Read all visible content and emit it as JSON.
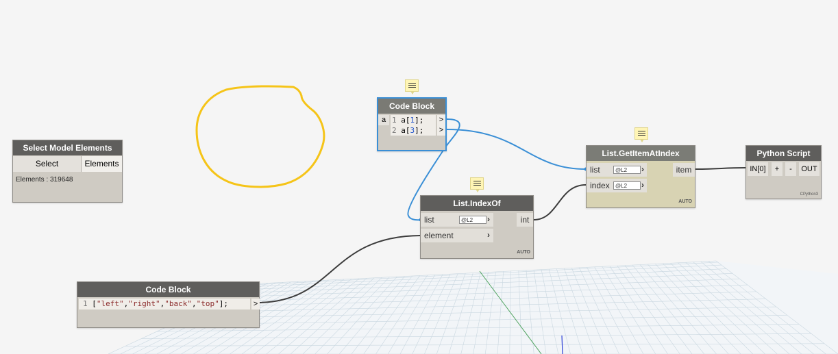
{
  "select_model_elements": {
    "title": "Select Model Elements",
    "select_button": "Select",
    "output_label": "Elements",
    "status": "Elements : 319648"
  },
  "code_block_top": {
    "title": "Code Block",
    "input_label": "a",
    "lines": [
      {
        "num": "1",
        "pre": "a[",
        "idx": "1",
        "post": "];"
      },
      {
        "num": "2",
        "pre": "a[",
        "idx": "3",
        "post": "];"
      }
    ],
    "out_glyph": ">"
  },
  "code_block_bottom": {
    "title": "Code Block",
    "line_num": "1",
    "open": "[",
    "strings": [
      "\"left\"",
      "\"right\"",
      "\"back\"",
      "\"top\""
    ],
    "close": "];",
    "sep": ",",
    "out_glyph": ">"
  },
  "list_index_of": {
    "title": "List.IndexOf",
    "inputs": [
      {
        "label": "list",
        "lacing": "@L2"
      },
      {
        "label": "element"
      }
    ],
    "output": "int",
    "mode": "AUTO"
  },
  "list_get_item": {
    "title": "List.GetItemAtIndex",
    "inputs": [
      {
        "label": "list",
        "lacing": "@L2"
      },
      {
        "label": "index",
        "lacing": "@L2"
      }
    ],
    "output": "item",
    "mode": "AUTO"
  },
  "python_script": {
    "title": "Python Script",
    "input": "IN[0]",
    "add": "+",
    "remove": "-",
    "output": "OUT",
    "engine": "CPython3"
  },
  "colors": {
    "selection_wire": "#3a8fd6",
    "wire": "#3c3c3c",
    "annotation": "#f5c418"
  }
}
